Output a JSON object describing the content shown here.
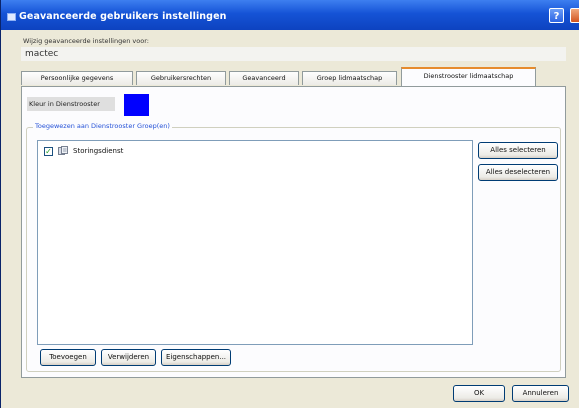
{
  "window": {
    "title": "Geavanceerde gebruikers instellingen",
    "help_label": "?"
  },
  "prompt_label": "Wijzig geavanceerde instellingen voor:",
  "user_value": "mactec",
  "tabs": [
    {
      "label": "Persoonlijke gegevens"
    },
    {
      "label": "Gebruikersrechten"
    },
    {
      "label": "Geavanceerd"
    },
    {
      "label": "Groep lidmaatschap"
    },
    {
      "label": "Dienstrooster lidmaatschap",
      "active": true
    }
  ],
  "color": {
    "label": "Kleur in Dienstrooster",
    "value": "#0000ff"
  },
  "group": {
    "legend": "Toegewezen aan Dienstrooster Groep(en)",
    "items": [
      {
        "label": "Storingsdienst",
        "checked": true
      }
    ]
  },
  "buttons": {
    "select_all": "Alles selecteren",
    "deselect_all": "Alles deselecteren",
    "add": "Toevoegen",
    "remove": "Verwijderen",
    "properties": "Eigenschappen...",
    "ok": "OK",
    "cancel": "Annuleren"
  }
}
